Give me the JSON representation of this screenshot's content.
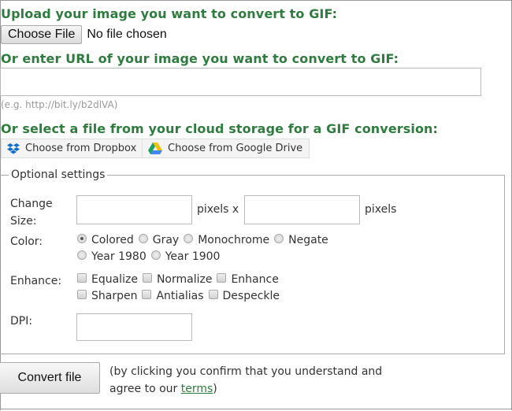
{
  "upload": {
    "heading": "Upload your image you want to convert to GIF:",
    "choose_file_label": "Choose File",
    "file_status": "No file chosen"
  },
  "url": {
    "heading": "Or enter URL of your image you want to convert to GIF:",
    "value": "",
    "hint": "(e.g. http://bit.ly/b2dlVA)"
  },
  "cloud": {
    "heading": "Or select a file from your cloud storage for a GIF conversion:",
    "dropbox_label": "Choose from Dropbox",
    "gdrive_label": "Choose from Google Drive"
  },
  "options": {
    "legend": "Optional settings",
    "change_size_label_1": "Change",
    "change_size_label_2": "Size:",
    "width_value": "",
    "height_value": "",
    "pixels_x": "pixels x",
    "pixels": "pixels",
    "color_label": "Color:",
    "color_options": [
      "Colored",
      "Gray",
      "Monochrome",
      "Negate",
      "Year 1980",
      "Year 1900"
    ],
    "color_selected": "Colored",
    "enhance_label": "Enhance:",
    "enhance_options": [
      "Equalize",
      "Normalize",
      "Enhance",
      "Sharpen",
      "Antialias",
      "Despeckle"
    ],
    "dpi_label": "DPI:",
    "dpi_value": ""
  },
  "submit": {
    "convert_label": "Convert file",
    "terms_line1": "(by clicking you confirm that you understand and",
    "terms_line2_prefix": "agree to our ",
    "terms_link": "terms",
    "terms_suffix": ")"
  },
  "colors": {
    "heading_green": "#2e7d3e",
    "dropbox_blue": "#0d6ecf"
  }
}
